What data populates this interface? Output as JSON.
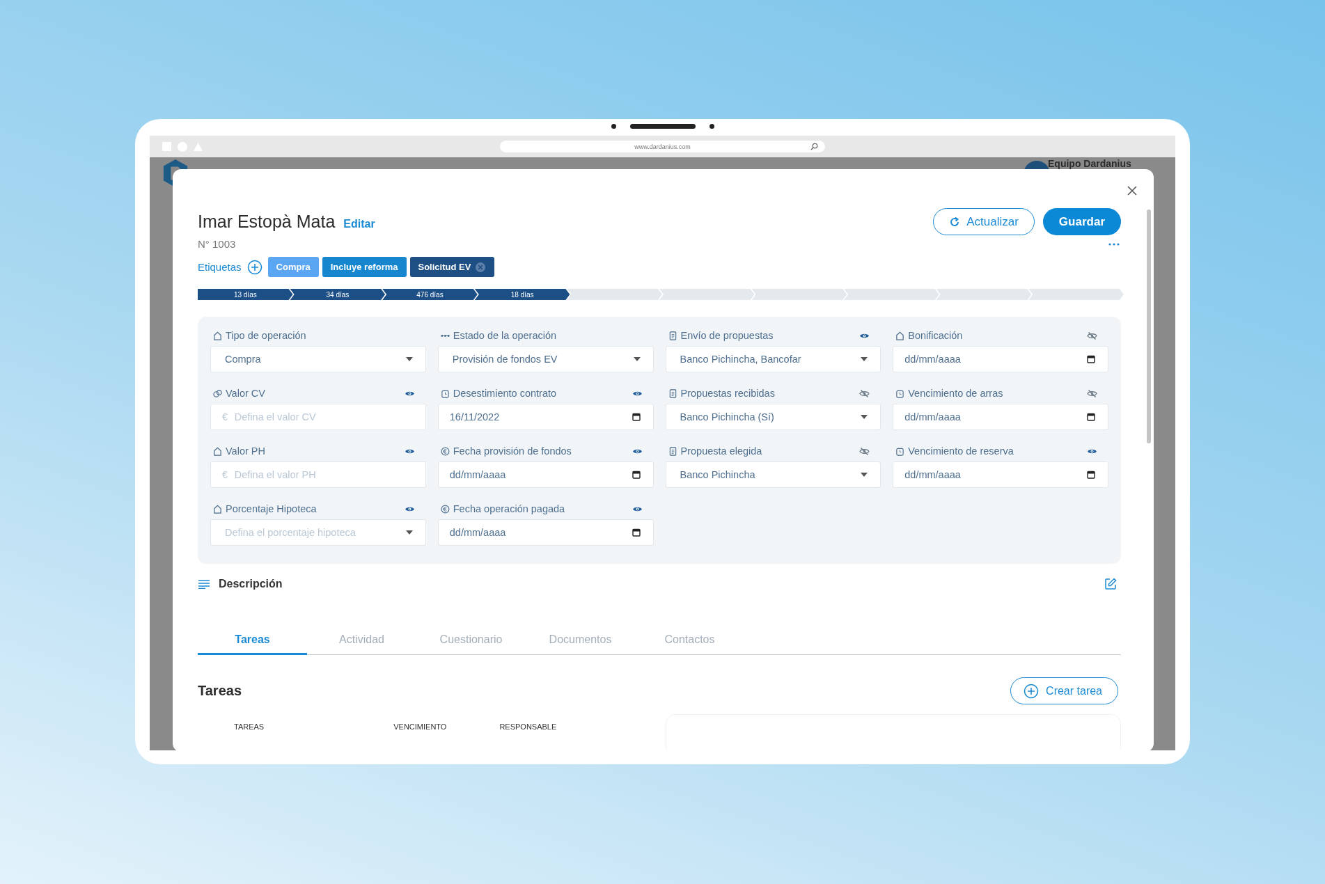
{
  "browser": {
    "url": "www.dardanius.com"
  },
  "app_header": {
    "team": "Equipo Dardanius"
  },
  "modal": {
    "title": "Imar Estopà Mata",
    "edit_link": "Editar",
    "number": "N° 1003",
    "buttons": {
      "refresh": "Actualizar",
      "save": "Guardar"
    },
    "tags_label": "Etiquetas",
    "tags": [
      {
        "label": "Compra",
        "color": "#5aa6f2",
        "removable": false
      },
      {
        "label": "Incluye reforma",
        "color": "#1687cf",
        "removable": false
      },
      {
        "label": "Solicitud EV",
        "color": "#1d4f85",
        "removable": true
      }
    ],
    "stages": [
      {
        "label": "13 días",
        "filled": true
      },
      {
        "label": "34 días",
        "filled": true
      },
      {
        "label": "476 días",
        "filled": true
      },
      {
        "label": "18 días",
        "filled": true
      },
      {
        "filled": false
      },
      {
        "filled": false
      },
      {
        "filled": false
      },
      {
        "filled": false
      },
      {
        "filled": false
      },
      {
        "filled": false
      }
    ],
    "fields": [
      {
        "label": "Tipo de operación",
        "kind": "select",
        "value": "Compra"
      },
      {
        "label": "Estado de la operación",
        "kind": "select",
        "value": "Provisión de fondos EV"
      },
      {
        "label": "Envío de propuestas",
        "kind": "select",
        "visible": true,
        "value": "Banco Pichincha, Bancofar"
      },
      {
        "label": "Bonificación",
        "kind": "date",
        "visible": false,
        "value": "dd/mm/aaaa"
      },
      {
        "label": "Valor CV",
        "kind": "text",
        "visible": true,
        "prefix": "€",
        "placeholder": "Defina el valor CV"
      },
      {
        "label": "Desestimiento contrato",
        "kind": "date",
        "visible": true,
        "value": "16/11/2022"
      },
      {
        "label": "Propuestas recibidas",
        "kind": "select",
        "visible": false,
        "value": "Banco Pichincha (Sí)"
      },
      {
        "label": "Vencimiento de arras",
        "kind": "date",
        "visible": false,
        "value": "dd/mm/aaaa"
      },
      {
        "label": "Valor PH",
        "kind": "text",
        "visible": true,
        "prefix": "€",
        "placeholder": "Defina el valor PH"
      },
      {
        "label": "Fecha provisión de fondos",
        "kind": "date",
        "visible": true,
        "value": "dd/mm/aaaa"
      },
      {
        "label": "Propuesta elegida",
        "kind": "select",
        "visible": false,
        "value": "Banco Pichincha"
      },
      {
        "label": "Vencimiento de reserva",
        "kind": "date",
        "visible": true,
        "value": "dd/mm/aaaa"
      },
      {
        "label": "Porcentaje Hipoteca",
        "kind": "select",
        "visible": true,
        "placeholder": "Defina el porcentaje hipoteca"
      },
      {
        "label": "Fecha operación pagada",
        "kind": "date",
        "visible": true,
        "value": "dd/mm/aaaa"
      }
    ],
    "description": {
      "title": "Descripción"
    },
    "tabs": [
      {
        "label": "Tareas",
        "selected": true
      },
      {
        "label": "Actividad",
        "selected": false
      },
      {
        "label": "Cuestionario",
        "selected": false
      },
      {
        "label": "Documentos",
        "selected": false
      },
      {
        "label": "Contactos",
        "selected": false
      }
    ],
    "tasks": {
      "title": "Tareas",
      "create_button": "Crear tarea",
      "columns": [
        "TAREAS",
        "VENCIMIENTO",
        "RESPONSABLE"
      ]
    }
  }
}
